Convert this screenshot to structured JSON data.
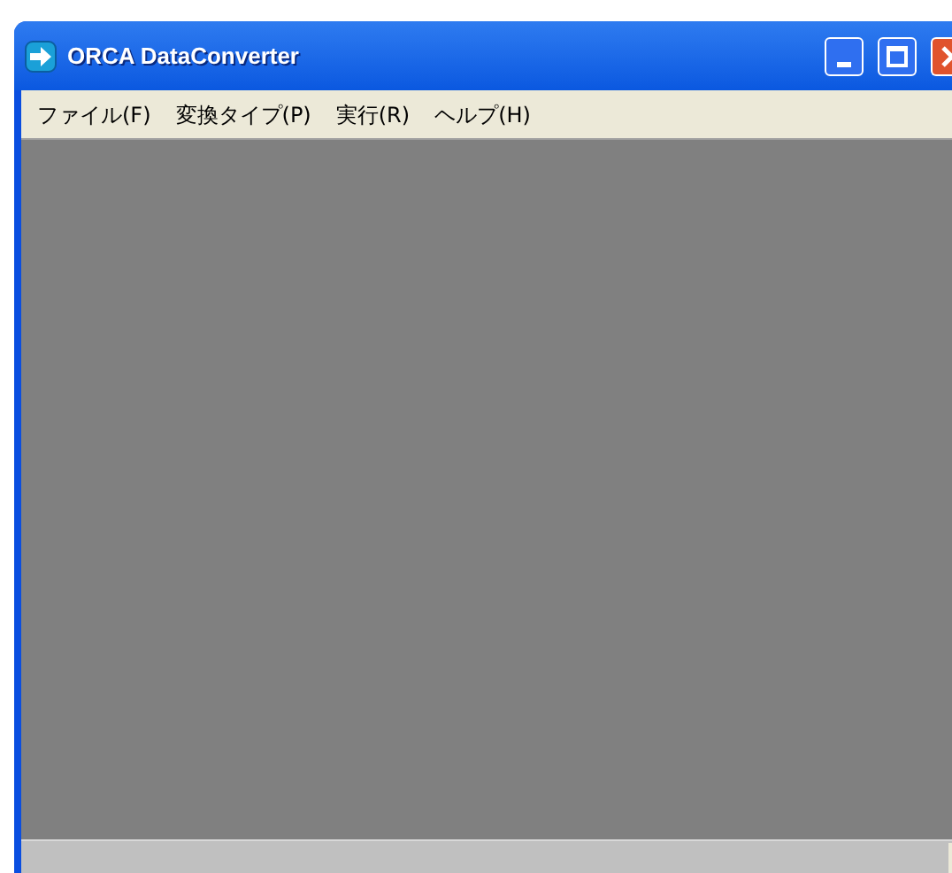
{
  "window": {
    "title": "ORCA DataConverter"
  },
  "menu": [
    {
      "label": "ファイル(F)"
    },
    {
      "label": "変換タイプ(P)"
    },
    {
      "label": "実行(R)"
    },
    {
      "label": "ヘルプ(H)"
    }
  ]
}
